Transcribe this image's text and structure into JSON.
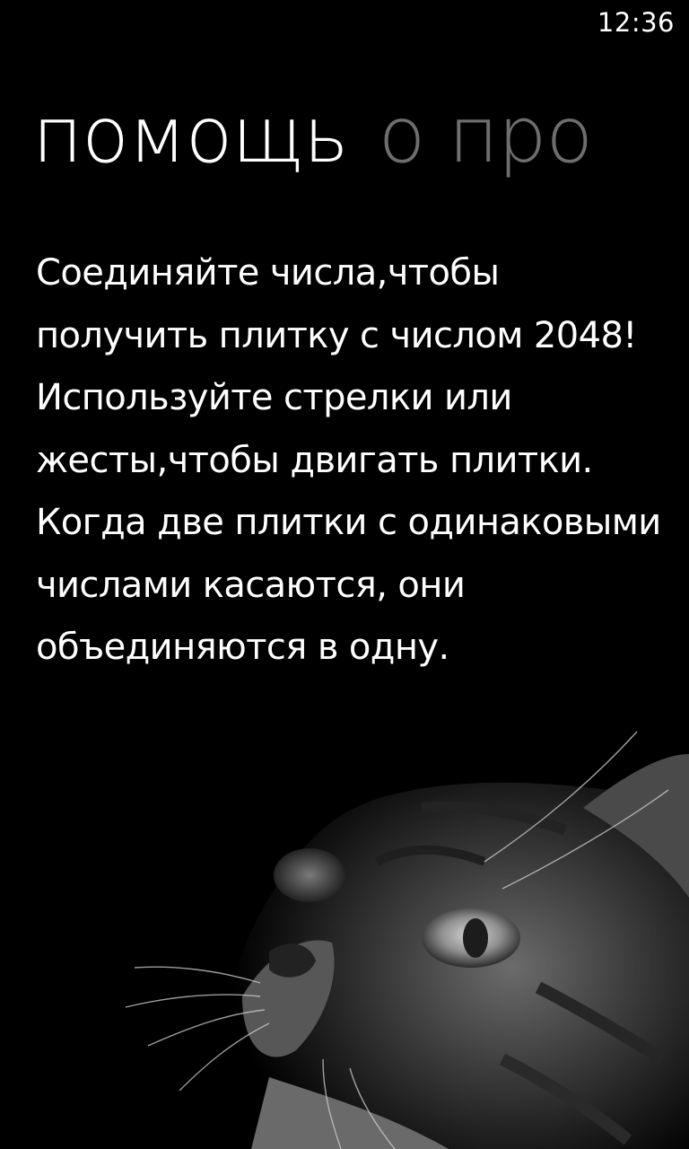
{
  "status_bar": {
    "time": "12:36"
  },
  "pivot": {
    "items": [
      {
        "label": "помощь",
        "active": true
      },
      {
        "label": "о про",
        "active": false
      }
    ]
  },
  "help": {
    "paragraphs": [
      "Соединяйте числа,чтобы получить плитку с числом 2048!",
      "Используйте стрелки или жесты,чтобы двигать плитки.",
      "Когда две плитки с одинаковыми числами касаются, они объединяются в одну."
    ]
  },
  "background": {
    "image": "cat-photo"
  }
}
